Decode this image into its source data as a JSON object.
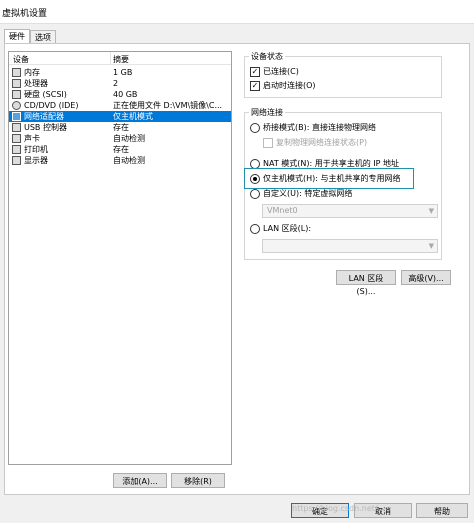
{
  "window": {
    "title": "虚拟机设置"
  },
  "tabs": [
    {
      "label": "硬件"
    },
    {
      "label": "选项"
    }
  ],
  "device_list": {
    "col_device": "设备",
    "col_summary": "摘要",
    "rows": [
      {
        "name": "内存",
        "value": "1 GB",
        "icon": "memory-icon"
      },
      {
        "name": "处理器",
        "value": "2",
        "icon": "cpu-icon"
      },
      {
        "name": "硬盘 (SCSI)",
        "value": "40 GB",
        "icon": "harddisk-icon"
      },
      {
        "name": "CD/DVD (IDE)",
        "value": "正在使用文件 D:\\VM\\镜像\\C...",
        "icon": "cdrom-icon"
      },
      {
        "name": "网络适配器",
        "value": "仅主机模式",
        "icon": "network-icon"
      },
      {
        "name": "USB 控制器",
        "value": "存在",
        "icon": "usb-icon"
      },
      {
        "name": "声卡",
        "value": "自动检测",
        "icon": "speaker-icon"
      },
      {
        "name": "打印机",
        "value": "存在",
        "icon": "printer-icon"
      },
      {
        "name": "显示器",
        "value": "自动检测",
        "icon": "monitor-icon"
      }
    ],
    "selected_index": 4
  },
  "buttons": {
    "add": "添加(A)...",
    "remove": "移除(R)",
    "lan_segments": "LAN 区段(S)...",
    "advanced": "高级(V)...",
    "ok": "确定",
    "cancel": "取消",
    "help": "帮助"
  },
  "device_status": {
    "title": "设备状态",
    "connected": "已连接(C)",
    "connect_at_power_on": "启动时连接(O)"
  },
  "network_connection": {
    "title": "网络连接",
    "bridged": "桥接模式(B): 直接连接物理网络",
    "replicate": "复制物理网络连接状态(P)",
    "nat": "NAT 模式(N): 用于共享主机的 IP 地址",
    "host_only": "仅主机模式(H): 与主机共享的专用网络",
    "custom": "自定义(U): 特定虚拟网络",
    "custom_value": "VMnet0",
    "lan_segment": "LAN 区段(L):",
    "lan_segment_value": ""
  },
  "watermark": "https://blog.csdn.net/..."
}
